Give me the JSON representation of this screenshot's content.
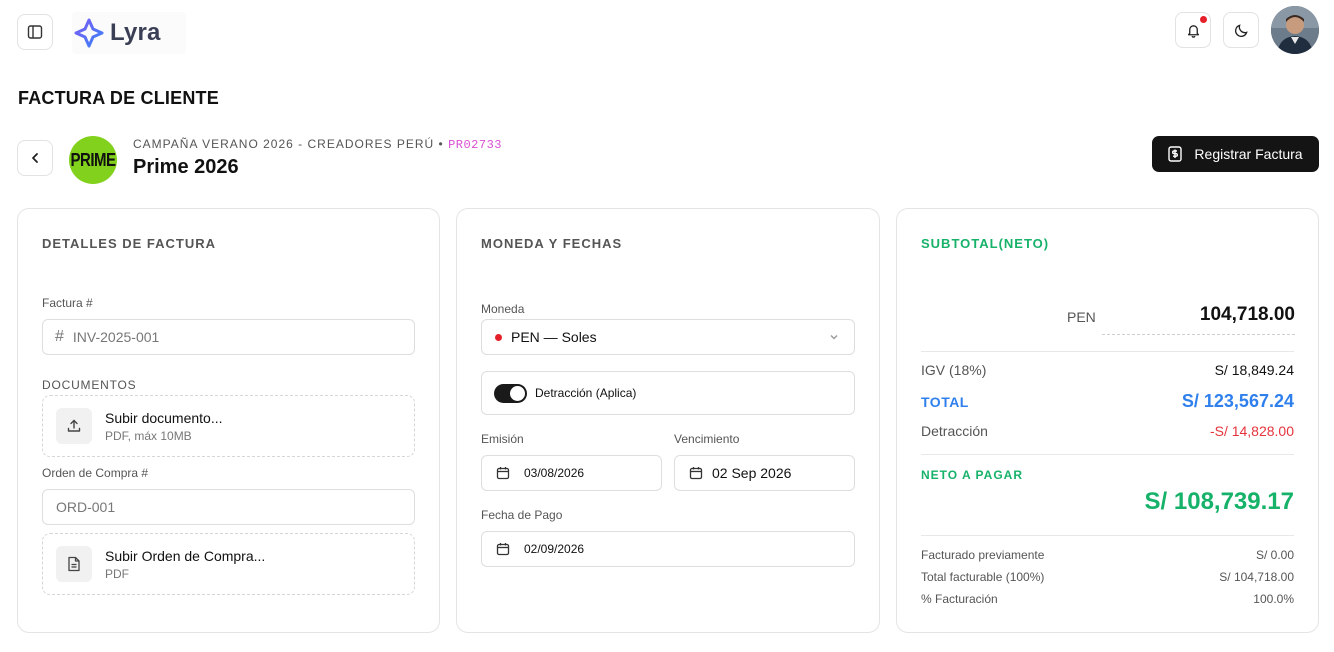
{
  "header": {
    "logo_text": "Lyra",
    "sidebar_toggle_icon": "sidebar-toggle-icon",
    "bell_icon": "bell-icon",
    "theme_icon": "moon-icon",
    "has_notification": true
  },
  "page": {
    "title": "FACTURA DE CLIENTE",
    "campaign": "CAMPAÑA VERANO 2026 - CREADORES PERÚ",
    "separator": " • ",
    "campaign_code": "PR02733",
    "brand_logo_text": "PRIME",
    "project_name": "Prime 2026",
    "primary_action": "Registrar Factura"
  },
  "details": {
    "title": "DETALLES DE FACTURA",
    "invoice_label": "Factura #",
    "invoice_placeholder": "INV-2025-001",
    "documents_label": "DOCUMENTOS",
    "upload_doc_title": "Subir documento...",
    "upload_doc_sub": "PDF, máx 10MB",
    "po_label": "Orden de Compra #",
    "po_placeholder": "ORD-001",
    "upload_po_title": "Subir Orden de Compra...",
    "upload_po_sub": "PDF"
  },
  "currency": {
    "title": "MONEDA Y FECHAS",
    "currency_label": "Moneda",
    "currency_value": "PEN — Soles",
    "detraction_label": "Detracción (Aplica)",
    "detraction_on": true,
    "emission_label": "Emisión",
    "emission_value": "03/08/2026",
    "due_label": "Vencimiento",
    "due_value": "02 Sep 2026",
    "payment_label": "Fecha de Pago",
    "payment_value": "02/09/2026"
  },
  "summary": {
    "title": "SUBTOTAL(NETO)",
    "currency_code": "PEN",
    "subtotal": "104,718.00",
    "igv_label": "IGV (18%)",
    "igv_value": "S/ 18,849.24",
    "total_label": "TOTAL",
    "total_value": "S/ 123,567.24",
    "detraction_label": "Detracción",
    "detraction_value": "-S/ 14,828.00",
    "net_label": "NETO A PAGAR",
    "net_value": "S/ 108,739.17",
    "prev_label": "Facturado previamente",
    "prev_value": "S/ 0.00",
    "billable_label": "Total facturable (100%)",
    "billable_value": "S/ 104,718.00",
    "pct_label": "% Facturación",
    "pct_value": "100.0%"
  },
  "colors": {
    "green": "#17b26a",
    "blue": "#2f80ed",
    "red": "#e5343c",
    "brand_green": "#82d11c",
    "code_pink": "#d94fd1"
  }
}
